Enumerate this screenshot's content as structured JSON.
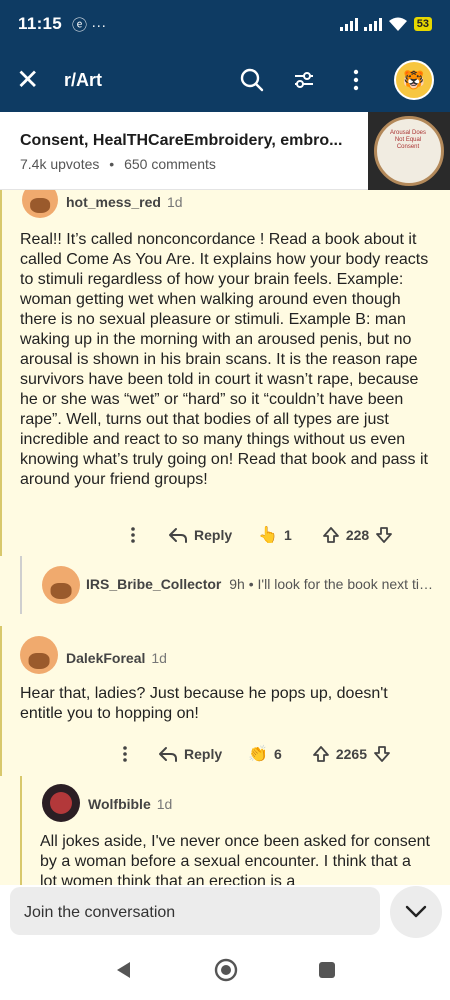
{
  "status": {
    "time": "11:15",
    "app_indicators": "ⓔ ···",
    "battery": "53"
  },
  "header": {
    "subreddit": "r/Art"
  },
  "post": {
    "title": "Consent, HealTHCareEmbroidery, embro...",
    "upvotes": "7.4k upvotes",
    "separator": "•",
    "comments": "650 comments",
    "thumb_text": "Arousal Does Not Equal Consent"
  },
  "comments": [
    {
      "user": "hot_mess_red",
      "age": "1d",
      "body": "Real!! It’s called nonconcordance ! Read a book about it called Come As You Are. It explains how your body reacts to stimuli regardless of how your brain feels. Example: woman getting wet when walking around even though there is no sexual pleasure or stimuli. Example B: man waking up in the morning with an aroused penis, but no arousal is shown in his brain scans. It is the reason rape survivors have been told in court it wasn’t rape, because he or she was “wet” or “hard” so it “couldn’t have been rape”. Well, turns out that bodies of all types are just incredible and react to so many things without us even knowing what’s truly going on! Read that book and pass it around your friend groups!",
      "reply": "Reply",
      "award_count": "1",
      "score": "228"
    },
    {
      "user": "IRS_Bribe_Collector",
      "age": "9h",
      "separator": "•",
      "snippet": "I'll look for the book next time I go to the bookstore"
    },
    {
      "user": "DalekForeal",
      "age": "1d",
      "body": "Hear that, ladies? Just because he pops up, doesn't entitle you to hopping on!",
      "reply": "Reply",
      "award_count": "6",
      "score": "2265"
    },
    {
      "user": "Wolfbible",
      "age": "1d",
      "body": "All jokes aside, I've never once been asked for consent by a woman before a sexual encounter. I think that a lot women think that an erection is a"
    }
  ],
  "join": {
    "placeholder": "Join the conversation"
  },
  "colors": {
    "header_bg": "#0e3b63",
    "comment_bg": "#fffbe2",
    "rail": "#d8c86c"
  }
}
